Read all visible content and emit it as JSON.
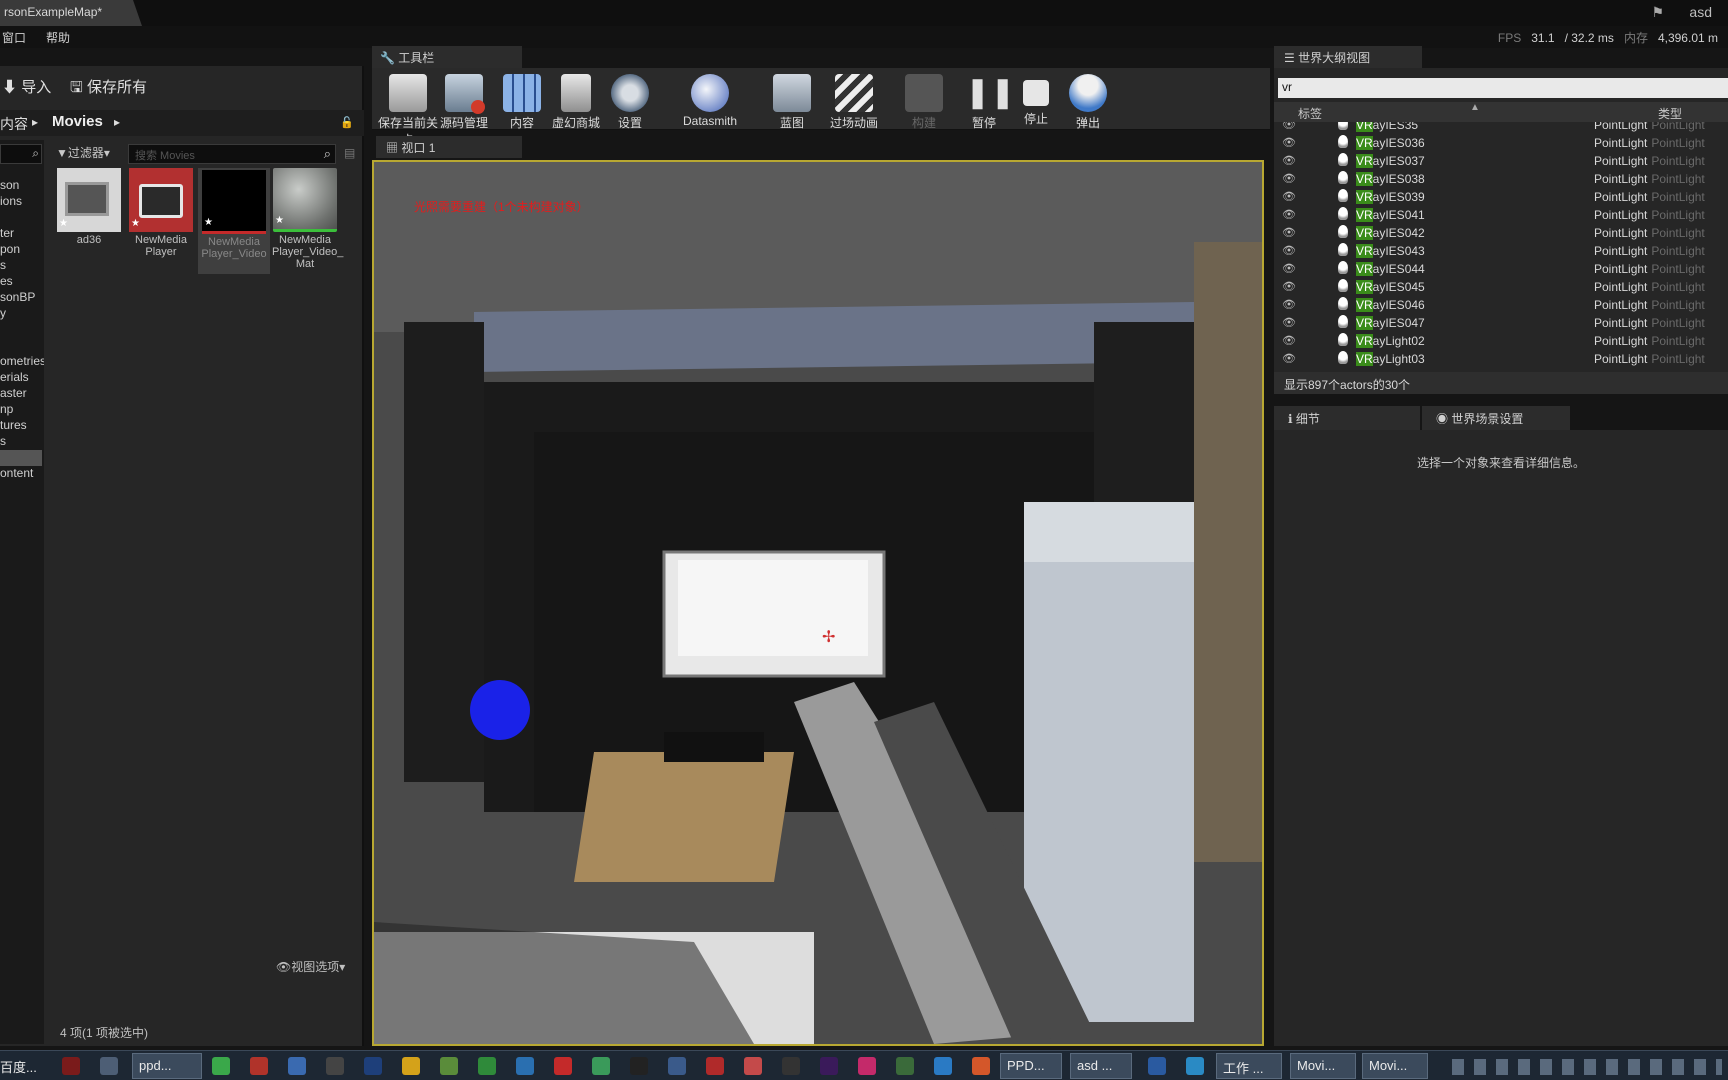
{
  "window": {
    "doc_tab": "rsonExampleMap*",
    "user": "asd",
    "flag_icon": "flag-icon"
  },
  "menu": {
    "items": [
      "窗口",
      "帮助"
    ]
  },
  "stats": {
    "fps_label": "FPS",
    "fps": "31.1",
    "ms": "/ 32.2 ms",
    "mem_label": "内存",
    "mem": "4,396.01 m"
  },
  "content_browser": {
    "import_label": "导入",
    "save_all_label": "保存所有",
    "path_root": "内容",
    "path_current": "Movies",
    "filter_label": "过滤器",
    "search_placeholder": "搜索 Movies",
    "tree_items": [
      "son",
      "ions",
      "",
      "ter",
      "pon",
      "s",
      "es",
      "sonBP",
      "y",
      "",
      "ometries",
      "erials",
      "aster",
      "np",
      "tures",
      "s",
      "",
      "ontent"
    ],
    "assets": [
      {
        "name": "ad36"
      },
      {
        "name": "NewMedia Player"
      },
      {
        "name": "NewMedia Player_Video"
      },
      {
        "name": "NewMedia Player_Video_ Mat"
      }
    ],
    "footer": "4 项(1 项被选中)",
    "view_options": "视图选项"
  },
  "toolbar": {
    "tab_label": "工具栏",
    "tools": [
      {
        "label": "保存当前关卡",
        "icon": "save-icon"
      },
      {
        "label": "源码管理",
        "icon": "source-control-icon"
      },
      {
        "label": "内容",
        "icon": "content-icon"
      },
      {
        "label": "虚幻商城",
        "icon": "marketplace-icon"
      },
      {
        "label": "设置",
        "icon": "settings-icon"
      },
      {
        "label": "Datasmith",
        "icon": "datasmith-icon"
      },
      {
        "label": "蓝图",
        "icon": "blueprint-icon"
      },
      {
        "label": "过场动画",
        "icon": "cinematics-icon"
      },
      {
        "label": "构建",
        "icon": "build-icon"
      },
      {
        "label": "暂停",
        "icon": "pause-icon"
      },
      {
        "label": "停止",
        "icon": "stop-icon"
      },
      {
        "label": "弹出",
        "icon": "eject-icon"
      }
    ]
  },
  "viewport": {
    "tab_label": "视口 1",
    "warning": "光照需要重建（1个未构建对象）"
  },
  "outliner": {
    "tab_label": "世界大纲视图",
    "search_value": "vr",
    "col_label": "标签",
    "col_type": "类型",
    "highlight": "VR",
    "rows": [
      {
        "rest": "ayIES35",
        "type": "PointLight"
      },
      {
        "rest": "ayIES036",
        "type": "PointLight"
      },
      {
        "rest": "ayIES037",
        "type": "PointLight"
      },
      {
        "rest": "ayIES038",
        "type": "PointLight"
      },
      {
        "rest": "ayIES039",
        "type": "PointLight"
      },
      {
        "rest": "ayIES041",
        "type": "PointLight"
      },
      {
        "rest": "ayIES042",
        "type": "PointLight"
      },
      {
        "rest": "ayIES043",
        "type": "PointLight"
      },
      {
        "rest": "ayIES044",
        "type": "PointLight"
      },
      {
        "rest": "ayIES045",
        "type": "PointLight"
      },
      {
        "rest": "ayIES046",
        "type": "PointLight"
      },
      {
        "rest": "ayIES047",
        "type": "PointLight"
      },
      {
        "rest": "ayLight02",
        "type": "PointLight"
      },
      {
        "rest": "ayLight03",
        "type": "PointLight"
      }
    ],
    "status": "显示897个actors的30个"
  },
  "details": {
    "tab_details": "细节",
    "tab_world_settings": "世界场景设置",
    "hint": "选择一个对象来查看详细信息。"
  },
  "taskbar": {
    "start": "百度...",
    "tasks": [
      "ppd...",
      "PPD...",
      "asd ...",
      "工作 ...",
      "Movi...",
      "Movi..."
    ]
  }
}
